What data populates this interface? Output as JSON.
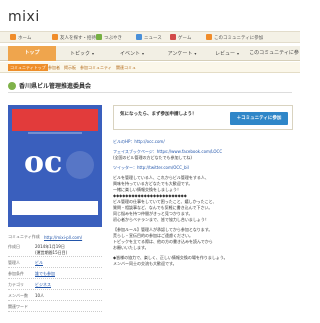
{
  "app": {
    "logo": "mixi"
  },
  "topnav": {
    "items": [
      {
        "icon": "home-icon",
        "label": "ホーム",
        "color": "#f08c2a"
      },
      {
        "icon": "people-icon",
        "label": "友人を探す・招待",
        "color": "#f08c2a"
      },
      {
        "icon": "chat-icon",
        "label": "つぶやき",
        "color": "#76b043"
      },
      {
        "icon": "news-icon",
        "label": "ニュース",
        "color": "#4a90d9"
      },
      {
        "icon": "game-icon",
        "label": "ゲーム",
        "color": "#d24a4a"
      },
      {
        "icon": "community-icon",
        "label": "このコミュニティに参加",
        "color": "#f08c2a"
      }
    ]
  },
  "tabs": [
    {
      "label": "トップ",
      "active": true
    },
    {
      "label": "トピック",
      "active": false
    },
    {
      "label": "イベント",
      "active": false
    },
    {
      "label": "アンケート",
      "active": false
    },
    {
      "label": "レビュー",
      "active": false
    },
    {
      "label": "このコミュニティに参加",
      "active": false
    }
  ],
  "subnav": {
    "current": "コミュニティトップ",
    "links": [
      "参加者",
      "掲示板",
      "参加コミュニティ",
      "関連コミュ"
    ]
  },
  "community": {
    "title": "香川県ビル管理推進委員会",
    "logo_text": "oc",
    "info": [
      {
        "key": "コミュニティ作成",
        "value": "http://mixi-pll.com/",
        "link": true
      },
      {
        "key": "作成日",
        "value": "2014年1月19日",
        "sub": "(運営期間15日目)"
      },
      {
        "key": "管理人",
        "value": "ビル",
        "link": true
      },
      {
        "key": "参加条件",
        "value": "誰でも参加",
        "link": true
      },
      {
        "key": "カテゴリ",
        "value": "ビジネス",
        "link": true
      },
      {
        "key": "メンバー数",
        "value": "10人"
      },
      {
        "key": "関連ワード",
        "value": ""
      }
    ]
  },
  "join": {
    "message": "気になったら、まず参加申請しよう！",
    "button": "＋コミュニティに参加"
  },
  "description": {
    "lines": [
      {
        "text": "ビルのHP：http://occ.com/",
        "type": "link"
      },
      {
        "text": "",
        "type": "gap"
      },
      {
        "text": "フェイスブックページ：https://www.facebook.com/LOCC",
        "type": "link"
      },
      {
        "text": "(全国のビル管理の方どなたでも参加してね)",
        "type": "text"
      },
      {
        "text": "",
        "type": "gap"
      },
      {
        "text": "ツイッター：http://twitter.com/OCC_bil",
        "type": "link"
      },
      {
        "text": "",
        "type": "gap"
      },
      {
        "text": "ビルを管理している人、これからビル管理をする人、",
        "type": "text"
      },
      {
        "text": "興味を持っている方どなたでも大歓迎です。",
        "type": "text"
      },
      {
        "text": "一緒に楽しい情報交換をしましょう！",
        "type": "text"
      },
      {
        "text": "◆◆◆◆◆◆◆◆◆◆◆◆◆◆◆◆◆◆◆◆◆◆◆◆",
        "type": "text"
      },
      {
        "text": "ビル管理の仕事をしていて困ったこと、嬉しかったこと、",
        "type": "text"
      },
      {
        "text": "質問・相談事など、なんでも気軽に書き込んで下さい。",
        "type": "text"
      },
      {
        "text": "同じ悩みを持つ仲間がきっと見つかります。",
        "type": "text"
      },
      {
        "text": "初心者からベテランまで、皆で協力し合いましょう！",
        "type": "text"
      },
      {
        "text": "",
        "type": "gap"
      },
      {
        "text": "【参加ルール】管理人が承認してから参加となります。",
        "type": "text"
      },
      {
        "text": "荒らし・宣伝目的の参加はご遠慮ください。",
        "type": "text"
      },
      {
        "text": "トピックを立てる際は、他の方の書き込みを読んでから",
        "type": "text"
      },
      {
        "text": "お願いいたします。",
        "type": "text"
      },
      {
        "text": "",
        "type": "gap"
      },
      {
        "text": "◆皆様の協力で、楽しく、正しい情報交換の場を作りましょう。",
        "type": "text"
      },
      {
        "text": "メンバー同士の交流も大歓迎です。",
        "type": "text"
      }
    ]
  }
}
